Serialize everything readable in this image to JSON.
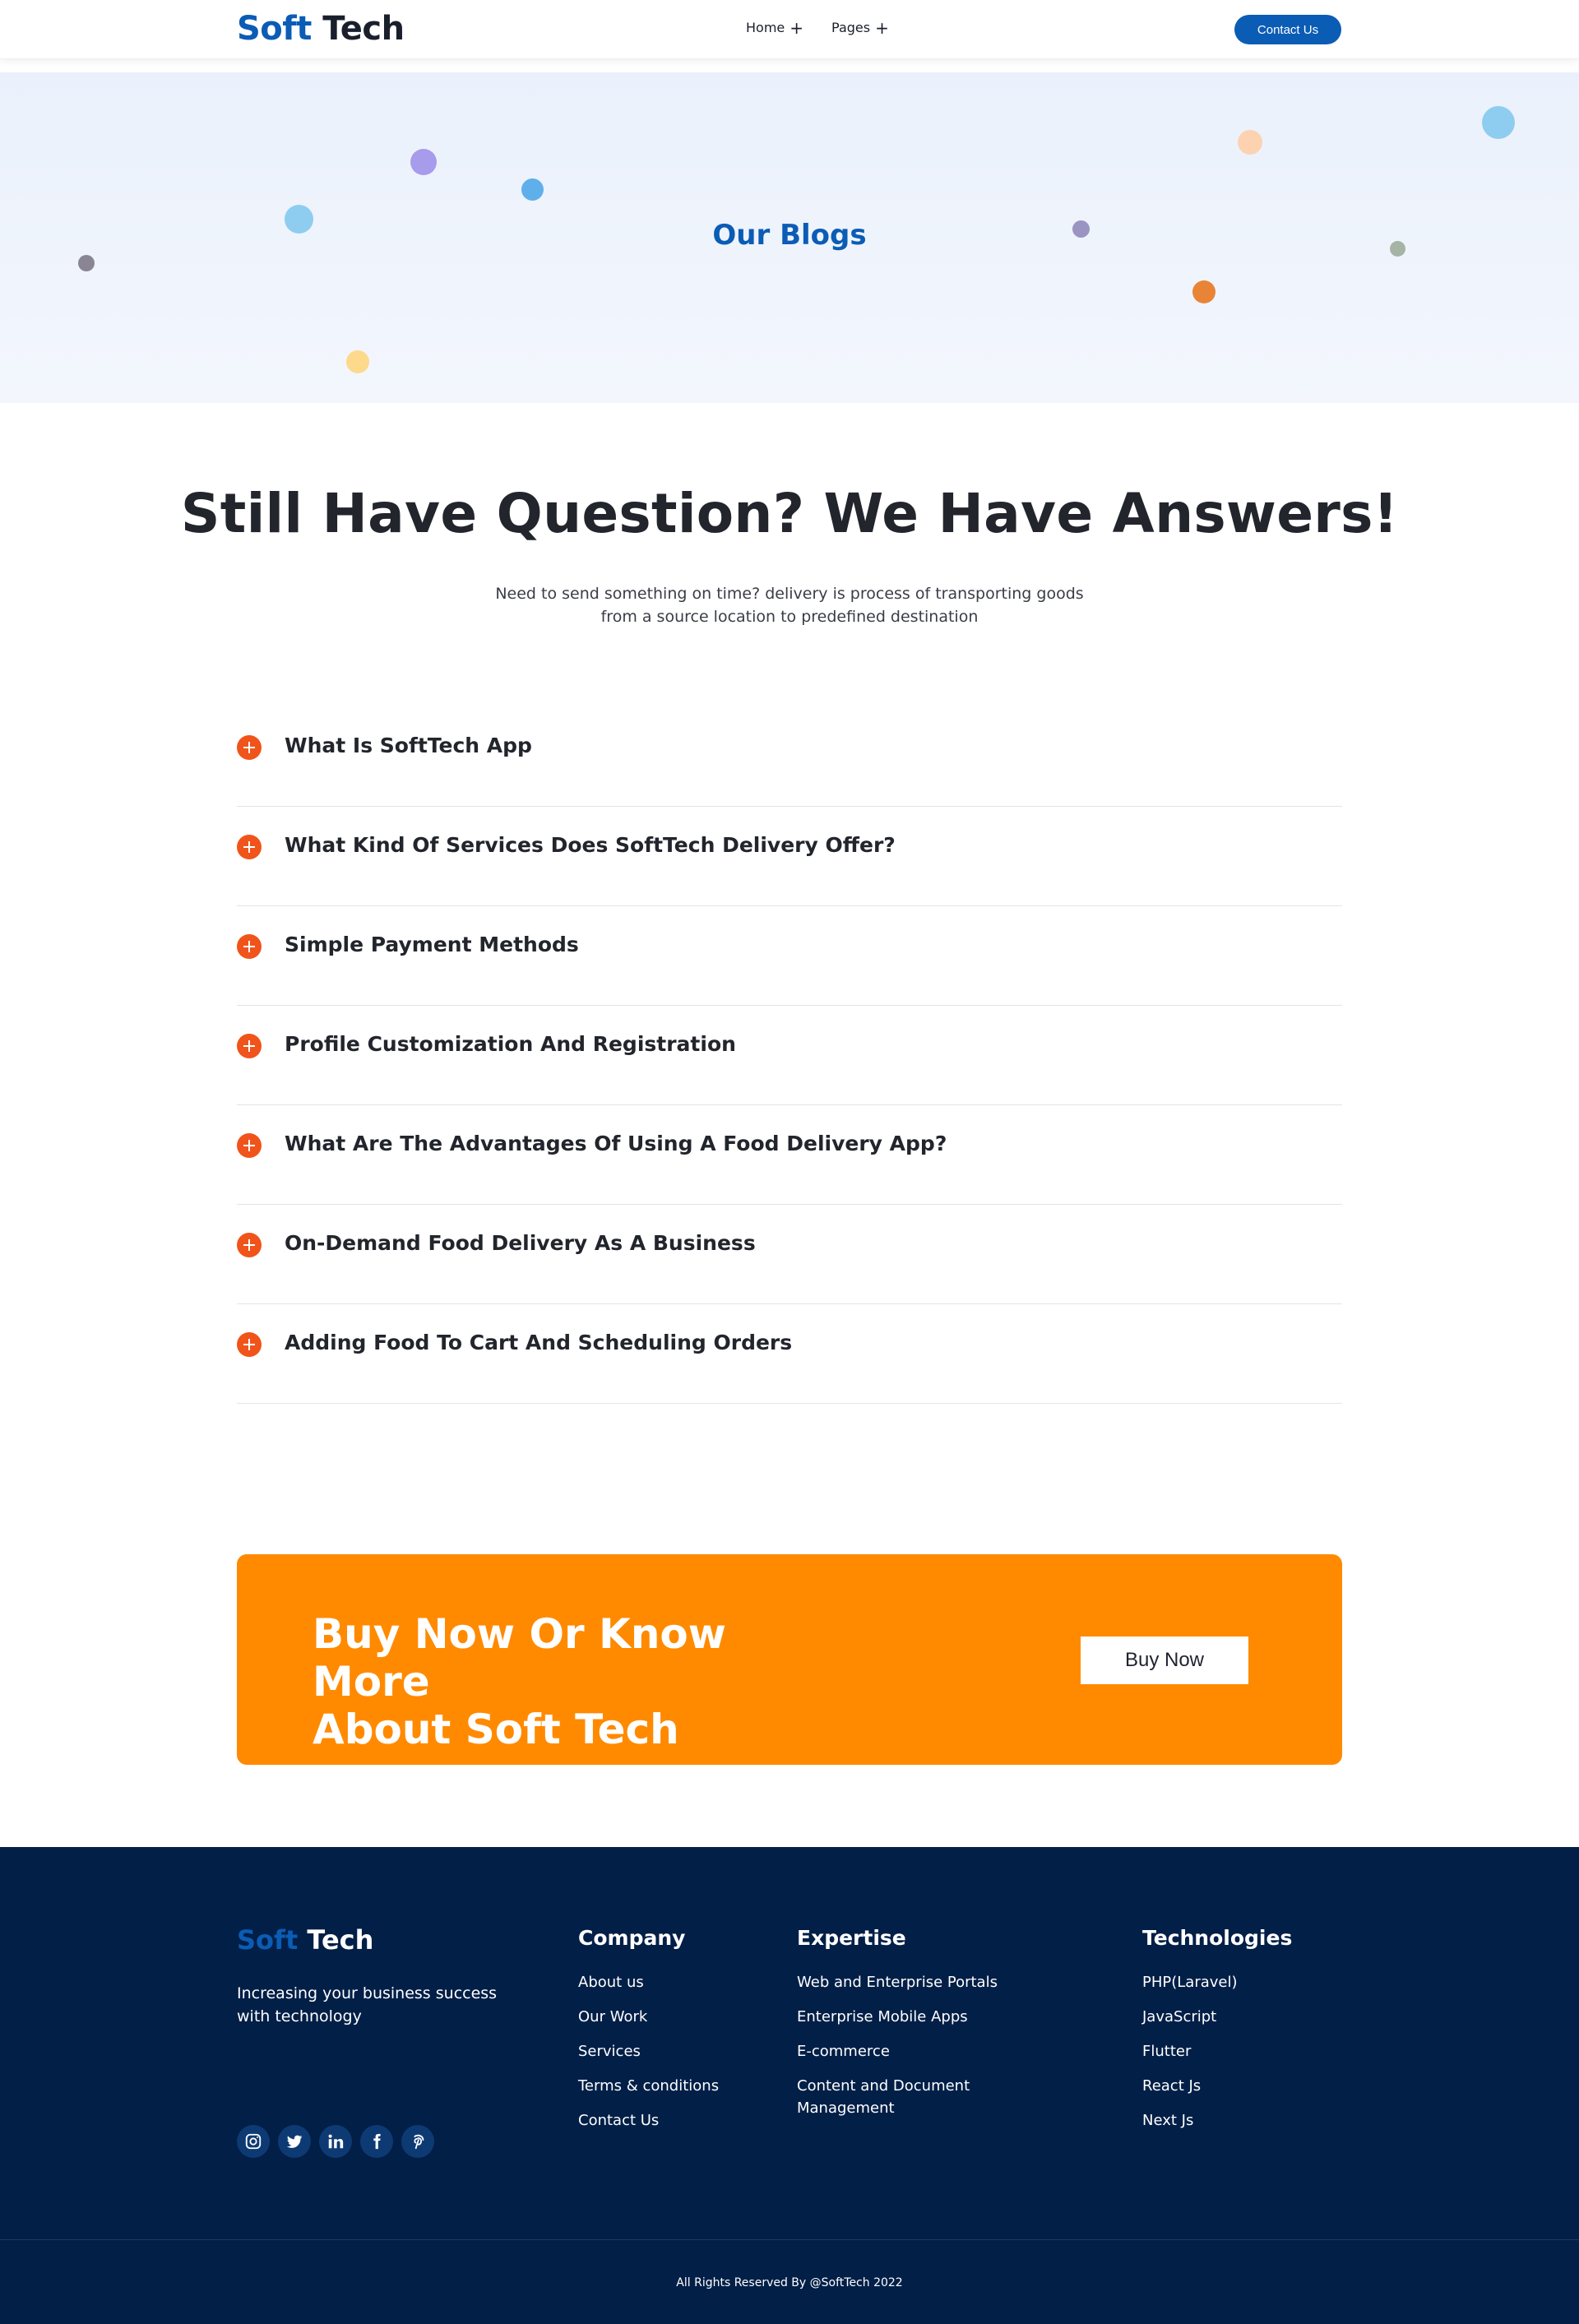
{
  "header": {
    "logo_soft": "Soft",
    "logo_tech": "Tech",
    "nav": [
      {
        "label": "Home",
        "icon": "plus-icon"
      },
      {
        "label": "Pages",
        "icon": "plus-icon"
      }
    ],
    "contact_label": "Contact Us"
  },
  "hero": {
    "title": "Our Blogs"
  },
  "faq": {
    "heading": "Still Have Question? We Have Answers!",
    "subtitle_line1": "Need to send something on time? delivery is process of transporting goods",
    "subtitle_line2": "from a source location to predefined destination",
    "items": [
      {
        "question": "What Is SoftTech App"
      },
      {
        "question": "What Kind Of Services Does SoftTech Delivery Offer?"
      },
      {
        "question": "Simple Payment Methods"
      },
      {
        "question": "Profile Customization And Registration"
      },
      {
        "question": "What Are The Advantages Of Using A Food Delivery App?"
      },
      {
        "question": "On-Demand Food Delivery As A Business"
      },
      {
        "question": "Adding Food To Cart And Scheduling Orders"
      }
    ]
  },
  "cta": {
    "title_line1": "Buy Now Or Know More",
    "title_line2": "About Soft Tech",
    "button_label": "Buy Now"
  },
  "footer": {
    "logo_soft": "Soft",
    "logo_tech": "Tech",
    "tagline": "Increasing your business success with technology",
    "socials": [
      "instagram-icon",
      "twitter-icon",
      "linkedin-icon",
      "facebook-icon",
      "pinterest-icon"
    ],
    "company": {
      "title": "Company",
      "links": [
        "About us",
        "Our Work",
        "Services",
        "Terms & conditions",
        "Contact Us"
      ]
    },
    "expertise": {
      "title": "Expertise",
      "links": [
        "Web and Enterprise Portals",
        "Enterprise Mobile Apps",
        "E-commerce",
        "Content and Document Management"
      ]
    },
    "technologies": {
      "title": "Technologies",
      "links": [
        "PHP(Laravel)",
        "JavaScript",
        "Flutter",
        "React Js",
        "Next Js"
      ]
    },
    "copyright": "All Rights Reserved By @SoftTech 2022"
  },
  "colors": {
    "brand_blue": "#0b5cb5",
    "accent_orange": "#ff8a00",
    "faq_icon_orange": "#f0541b",
    "footer_navy": "#021f47"
  }
}
